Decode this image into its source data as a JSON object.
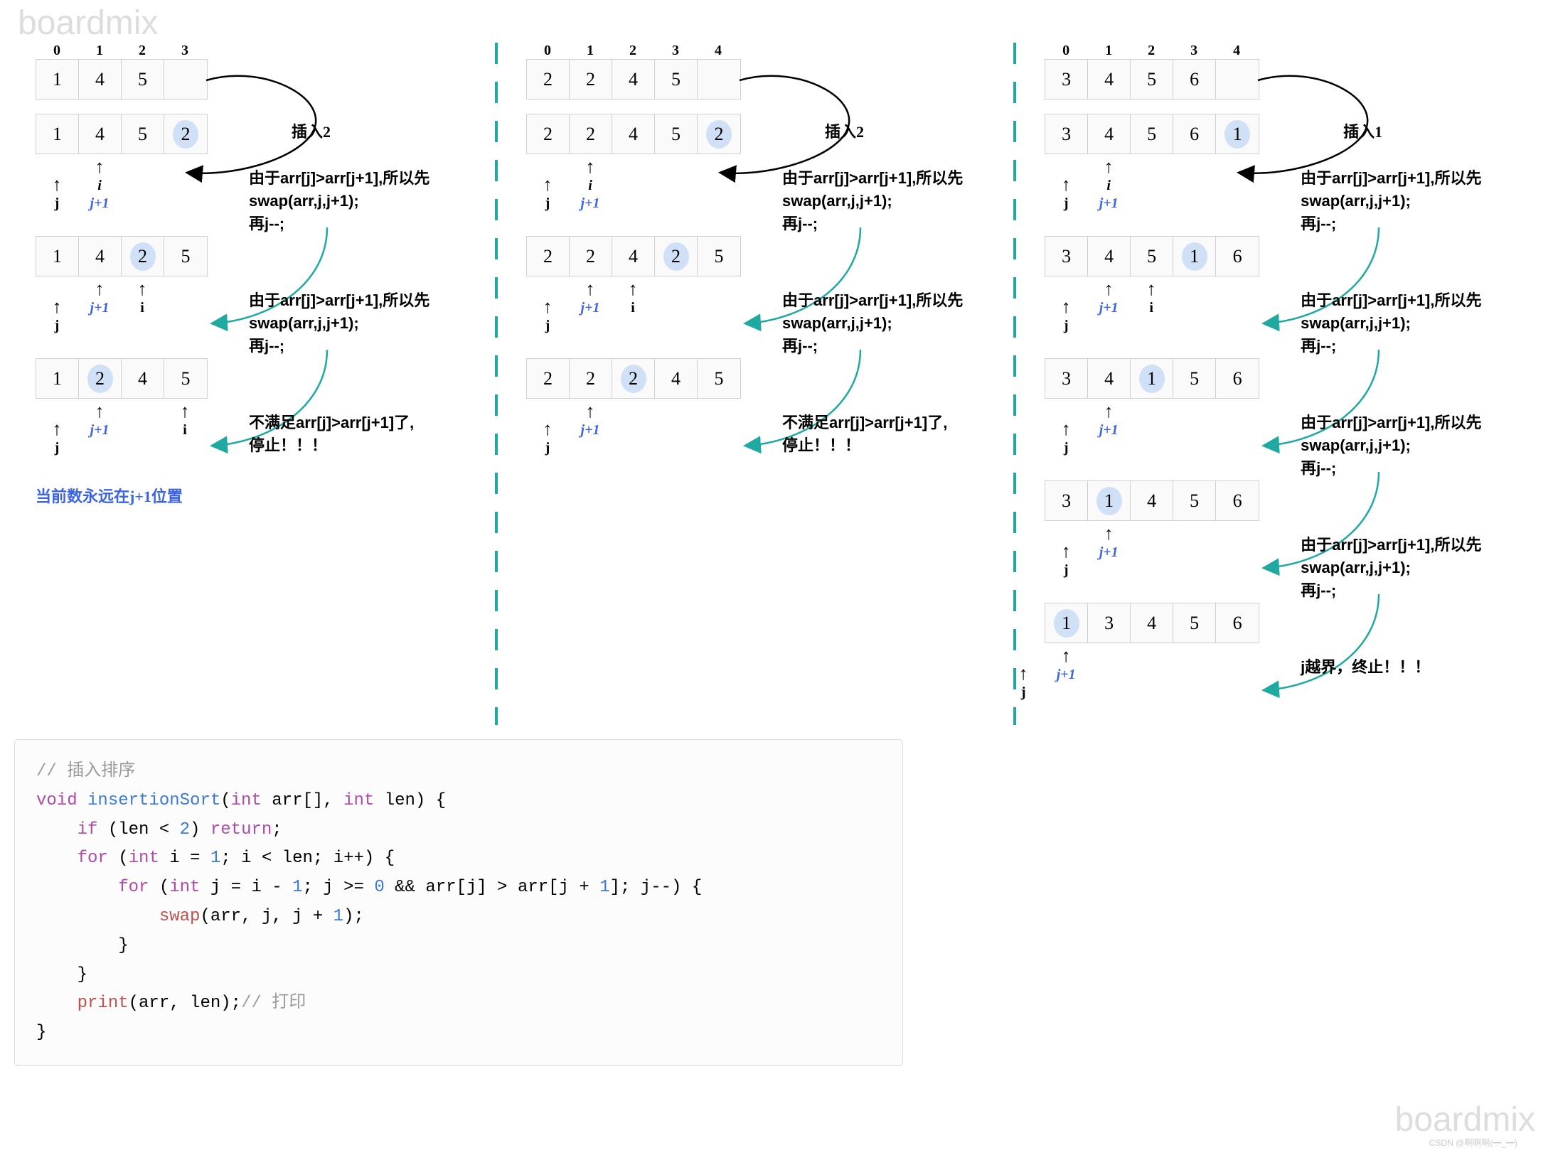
{
  "watermark": "boardmix",
  "csdn": "CSDN @啊啊啊(┯_┯)",
  "columns": [
    {
      "indices": [
        "0",
        "1",
        "2",
        "3"
      ],
      "insert_label": "插入2",
      "steps": [
        {
          "cells": [
            "1",
            "4",
            "5",
            ""
          ],
          "hl": null,
          "ptrs": []
        },
        {
          "cells": [
            "1",
            "4",
            "5",
            "2"
          ],
          "hl": 3,
          "ptrs": [
            {
              "pos": 2,
              "k": "j"
            },
            {
              "pos": 3,
              "k": "jp1"
            },
            {
              "pos": 3,
              "k": "i"
            }
          ],
          "note": "由于arr[j]>arr[j+1],所以先swap(arr,j,j+1);\n再j--;"
        },
        {
          "cells": [
            "1",
            "4",
            "2",
            "5"
          ],
          "hl": 2,
          "ptrs": [
            {
              "pos": 1,
              "k": "j"
            },
            {
              "pos": 2,
              "k": "jp1"
            },
            {
              "pos": 3,
              "k": "i"
            }
          ],
          "note": "由于arr[j]>arr[j+1],所以先swap(arr,j,j+1);\n再j--;"
        },
        {
          "cells": [
            "1",
            "2",
            "4",
            "5"
          ],
          "hl": 1,
          "ptrs": [
            {
              "pos": 0,
              "k": "j"
            },
            {
              "pos": 1,
              "k": "jp1"
            },
            {
              "pos": 3,
              "k": "i"
            }
          ],
          "note": "不满足arr[j]>arr[j+1]了,\n停止！！！"
        }
      ],
      "bottom_note": "当前数永远在j+1位置"
    },
    {
      "indices": [
        "0",
        "1",
        "2",
        "3",
        "4"
      ],
      "insert_label": "插入2",
      "steps": [
        {
          "cells": [
            "2",
            "2",
            "4",
            "5",
            ""
          ],
          "hl": null,
          "ptrs": []
        },
        {
          "cells": [
            "2",
            "2",
            "4",
            "5",
            "2"
          ],
          "hl": 4,
          "ptrs": [
            {
              "pos": 3,
              "k": "j"
            },
            {
              "pos": 4,
              "k": "jp1"
            },
            {
              "pos": 4,
              "k": "i"
            }
          ],
          "note": "由于arr[j]>arr[j+1],所以先swap(arr,j,j+1);\n再j--;"
        },
        {
          "cells": [
            "2",
            "2",
            "4",
            "2",
            "5"
          ],
          "hl": 3,
          "ptrs": [
            {
              "pos": 2,
              "k": "j"
            },
            {
              "pos": 3,
              "k": "jp1"
            },
            {
              "pos": 4,
              "k": "i"
            }
          ],
          "note": "由于arr[j]>arr[j+1],所以先swap(arr,j,j+1);\n再j--;"
        },
        {
          "cells": [
            "2",
            "2",
            "2",
            "4",
            "5"
          ],
          "hl": 2,
          "ptrs": [
            {
              "pos": 1,
              "k": "j"
            },
            {
              "pos": 2,
              "k": "jp1"
            }
          ],
          "note": "不满足arr[j]>arr[j+1]了,\n停止！！！"
        }
      ]
    },
    {
      "indices": [
        "0",
        "1",
        "2",
        "3",
        "4"
      ],
      "insert_label": "插入1",
      "steps": [
        {
          "cells": [
            "3",
            "4",
            "5",
            "6",
            ""
          ],
          "hl": null,
          "ptrs": []
        },
        {
          "cells": [
            "3",
            "4",
            "5",
            "6",
            "1"
          ],
          "hl": 4,
          "ptrs": [
            {
              "pos": 3,
              "k": "j"
            },
            {
              "pos": 4,
              "k": "jp1"
            },
            {
              "pos": 4,
              "k": "i"
            }
          ],
          "note": "由于arr[j]>arr[j+1],所以先swap(arr,j,j+1);\n再j--;"
        },
        {
          "cells": [
            "3",
            "4",
            "5",
            "1",
            "6"
          ],
          "hl": 3,
          "ptrs": [
            {
              "pos": 2,
              "k": "j"
            },
            {
              "pos": 3,
              "k": "jp1"
            },
            {
              "pos": 4,
              "k": "i"
            }
          ],
          "note": "由于arr[j]>arr[j+1],所以先swap(arr,j,j+1);\n再j--;"
        },
        {
          "cells": [
            "3",
            "4",
            "1",
            "5",
            "6"
          ],
          "hl": 2,
          "ptrs": [
            {
              "pos": 1,
              "k": "j"
            },
            {
              "pos": 2,
              "k": "jp1"
            }
          ],
          "note": "由于arr[j]>arr[j+1],所以先swap(arr,j,j+1);\n再j--;"
        },
        {
          "cells": [
            "3",
            "1",
            "4",
            "5",
            "6"
          ],
          "hl": 1,
          "ptrs": [
            {
              "pos": 0,
              "k": "j"
            },
            {
              "pos": 1,
              "k": "jp1"
            }
          ],
          "note": "由于arr[j]>arr[j+1],所以先swap(arr,j,j+1);\n再j--;"
        },
        {
          "cells": [
            "1",
            "3",
            "4",
            "5",
            "6"
          ],
          "hl": 0,
          "ptrs": [
            {
              "pos": -1,
              "k": "j"
            },
            {
              "pos": 0,
              "k": "jp1"
            }
          ],
          "note": "j越界，终止！！！"
        }
      ]
    }
  ],
  "ptr_labels": {
    "j": "j",
    "jp1": "j+1",
    "i": "i"
  },
  "code": {
    "lines": [
      {
        "t": "cmt",
        "s": "// 插入排序"
      },
      {
        "t": "raw",
        "s": "void insertionSort(int arr[], int len) {"
      },
      {
        "t": "raw",
        "s": "    if (len < 2) return;"
      },
      {
        "t": "raw",
        "s": "    for (int i = 1; i < len; i++) {"
      },
      {
        "t": "raw",
        "s": "        for (int j = i - 1; j >= 0 && arr[j] > arr[j + 1]; j--) {"
      },
      {
        "t": "raw",
        "s": "            swap(arr, j, j + 1);"
      },
      {
        "t": "raw",
        "s": "        }"
      },
      {
        "t": "raw",
        "s": "    }"
      },
      {
        "t": "raw",
        "s": "    print(arr, len);// 打印"
      },
      {
        "t": "raw",
        "s": "}"
      }
    ]
  }
}
